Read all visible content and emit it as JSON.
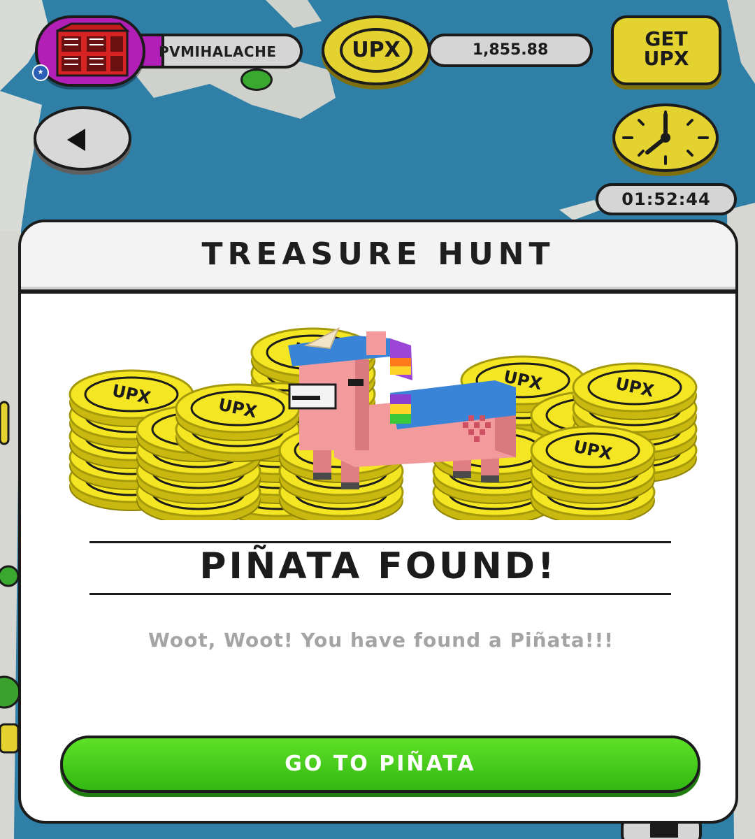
{
  "hud": {
    "username": "PVMIHALACHE",
    "currency_label": "UPX",
    "balance": "1,855.88",
    "get_upx_label": "GET UPX",
    "timer": "01:52:44"
  },
  "modal": {
    "title": "TREASURE HUNT",
    "found_title": "PIÑATA FOUND!",
    "message": "Woot, Woot! You have found a Piñata!!!",
    "cta_label": "GO TO PIÑATA",
    "coin_label": "UPX"
  },
  "colors": {
    "ocean": "#2f7fa6",
    "coin_yellow": "#e3d230",
    "avatar_purple": "#b21fb7",
    "cta_green": "#3cc41a",
    "pinata_pink": "#f29a9c"
  },
  "icons": [
    "back-arrow-icon",
    "clock-icon",
    "building-avatar-icon",
    "upx-coin-icon"
  ]
}
